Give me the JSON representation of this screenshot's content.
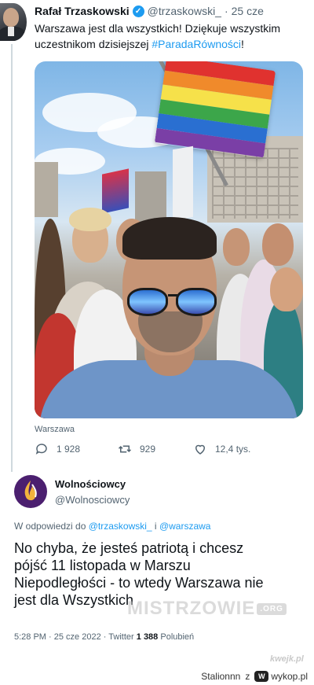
{
  "tweet1": {
    "author_name": "Rafał Trzaskowski",
    "author_handle": "@trzaskowski_",
    "separator": "·",
    "timestamp": "25 cze",
    "text_line1": "Warszawa jest dla wszystkich! Dziękuje wszystkim",
    "text_line2": "uczestnikom dzisiejszej ",
    "hashtag": "#ParadaRówności",
    "text_suffix": "!",
    "location": "Warszawa",
    "replies": "1 928",
    "retweets": "929",
    "likes": "12,4 tys."
  },
  "tweet2": {
    "author_name": "Wolnościowcy",
    "author_handle": "@Wolnosciowcy",
    "reply_prefix": "W odpowiedzi do ",
    "reply_mention1": "@trzaskowski_",
    "reply_joiner": " i ",
    "reply_mention2": "@warszawa",
    "text_lines": [
      "No chyba, że jesteś patriotą i chcesz",
      "pójść 11 listopada w Marszu",
      "Niepodległości - to wtedy Warszawa nie",
      "jest dla Wszystkich"
    ],
    "time": "5:28 PM",
    "date": "25 cze 2022",
    "source": "Twitter",
    "likes_count": "1 388",
    "likes_label": "Polubień"
  },
  "watermark": {
    "text": "MISTRZOWIE",
    "suffix": ".ORG"
  },
  "footer": {
    "kwejk_mark": "kwejk.pl",
    "user": "Stalionnn",
    "joiner": "z",
    "site": "wykop.pl"
  },
  "colors": {
    "link_blue": "#1d9bf0",
    "secondary_text": "#536471",
    "wolnosciowcy_purple": "#4b1f6f",
    "flame_gold": "#f2b33d"
  },
  "icons": {
    "verified": "verified-badge-icon",
    "reply": "speech-bubble-icon",
    "retweet": "retweet-arrows-icon",
    "like": "heart-icon",
    "wolnosciowcy_logo": "flame-icon",
    "wykop": "wykop-logo-icon"
  }
}
